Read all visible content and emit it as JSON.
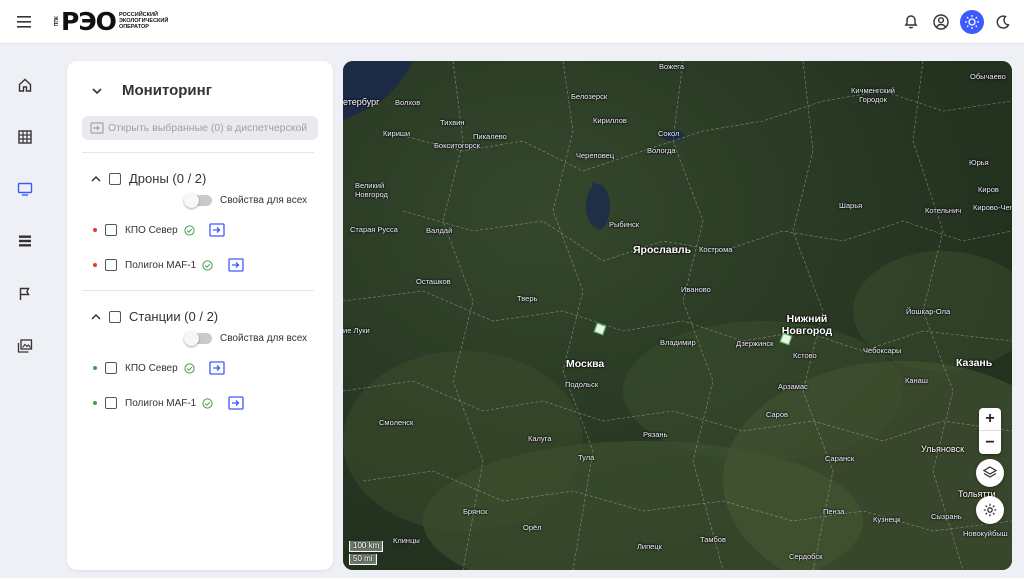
{
  "header": {
    "logo_prefix": "ППК",
    "logo_mark": "РЭО",
    "logo_text": "Российский экологический оператор",
    "icons": [
      "menu-icon",
      "bell-icon",
      "account-icon",
      "sun-icon",
      "moon-icon"
    ]
  },
  "sidebar": {
    "items": [
      "home-icon",
      "grid-icon",
      "monitor-icon",
      "list-icon",
      "flag-icon",
      "gallery-icon"
    ],
    "active": "monitor-icon",
    "active_color": "#3d5afe"
  },
  "panel": {
    "title": "Мониторинг",
    "open_selected_label": "Открыть выбранные (0) в диспетчерской",
    "groups": [
      {
        "title": "Дроны (0 / 2)",
        "toggle_label": "Свойства для всех",
        "items": [
          {
            "label": "КПО Север",
            "dot_color": "#e53935"
          },
          {
            "label": "Полигон МАF-1",
            "dot_color": "#e53935"
          }
        ]
      },
      {
        "title": "Станции (0 / 2)",
        "toggle_label": "Свойства для всех",
        "items": [
          {
            "label": "КПО Север",
            "dot_color": "#43a047"
          },
          {
            "label": "Полигон МАF-1",
            "dot_color": "#43a047"
          }
        ]
      }
    ]
  },
  "map": {
    "labels": [
      {
        "text": "Вожега"
      },
      {
        "text": "Кичменгский Городок"
      },
      {
        "text": "Обычаево"
      },
      {
        "text": "етербург"
      },
      {
        "text": "Волхов"
      },
      {
        "text": "Белозерск"
      },
      {
        "text": "Тихвин"
      },
      {
        "text": "Кириллов"
      },
      {
        "text": "Кириши"
      },
      {
        "text": "Пикалево"
      },
      {
        "text": "Бокситогорск"
      },
      {
        "text": "Сокол"
      },
      {
        "text": "Вологда"
      },
      {
        "text": "Череповец"
      },
      {
        "text": "Юрья"
      },
      {
        "text": "Великий Новгород"
      },
      {
        "text": "Киров"
      },
      {
        "text": "Котельнич"
      },
      {
        "text": "Кирово-Чепецк"
      },
      {
        "text": "Шарья"
      },
      {
        "text": "Рыбинск"
      },
      {
        "text": "Старая Русса"
      },
      {
        "text": "Валдай"
      },
      {
        "text": "Ярославль"
      },
      {
        "text": "Кострома"
      },
      {
        "text": "Осташков"
      },
      {
        "text": "Тверь"
      },
      {
        "text": "Иваново"
      },
      {
        "text": "Нижний Новгород"
      },
      {
        "text": "Йошкар-Ола"
      },
      {
        "text": "ие Луки"
      },
      {
        "text": "Владимир"
      },
      {
        "text": "Дзержинск"
      },
      {
        "text": "Кстово"
      },
      {
        "text": "Чебоксары"
      },
      {
        "text": "Москва"
      },
      {
        "text": "Подольск"
      },
      {
        "text": "Арзамас"
      },
      {
        "text": "Канаш"
      },
      {
        "text": "Казань"
      },
      {
        "text": "Смоленск"
      },
      {
        "text": "Саров"
      },
      {
        "text": "Калуга"
      },
      {
        "text": "Рязань"
      },
      {
        "text": "Ульяновск"
      },
      {
        "text": "Тула"
      },
      {
        "text": "Саранск"
      },
      {
        "text": "Тольятти"
      },
      {
        "text": "Брянск"
      },
      {
        "text": "Орёл"
      },
      {
        "text": "Пенза"
      },
      {
        "text": "Кузнецк"
      },
      {
        "text": "Сызрань"
      },
      {
        "text": "Липецк"
      },
      {
        "text": "Тамбов"
      },
      {
        "text": "Новокуйбыш"
      },
      {
        "text": "Клинцы"
      },
      {
        "text": "Сердобск"
      }
    ],
    "scale_km": "100 km",
    "scale_mi": "50 mi",
    "zoom_in": "+",
    "zoom_out": "−"
  }
}
